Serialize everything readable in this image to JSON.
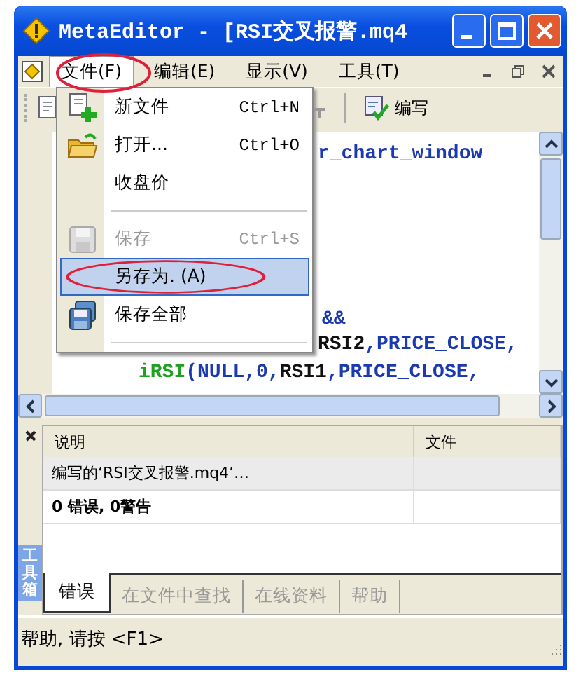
{
  "window": {
    "title": "MetaEditor - [RSI交叉报警.mq4"
  },
  "menu_bar": {
    "items": [
      {
        "label": "文件(F)",
        "selected": true
      },
      {
        "label": "编辑(E)",
        "selected": false
      },
      {
        "label": "显示(V)",
        "selected": false
      },
      {
        "label": "工具(T)",
        "selected": false
      }
    ]
  },
  "toolbar": {
    "buttons": [
      {
        "label": "编写"
      }
    ]
  },
  "file_menu": {
    "items": [
      {
        "kind": "item",
        "label": "新文件",
        "shortcut": "Ctrl+N",
        "disabled": false,
        "selected": false
      },
      {
        "kind": "item",
        "label": "打开...",
        "shortcut": "Ctrl+O",
        "disabled": false,
        "selected": false
      },
      {
        "kind": "item",
        "label": "收盘价",
        "disabled": false,
        "selected": false
      },
      {
        "kind": "separator"
      },
      {
        "kind": "item",
        "label": "保存",
        "shortcut": "Ctrl+S",
        "disabled": true,
        "selected": false
      },
      {
        "kind": "item",
        "label": "另存为. (A)",
        "disabled": false,
        "selected": true
      },
      {
        "kind": "item",
        "label": "保存全部",
        "disabled": false,
        "selected": false
      },
      {
        "kind": "separator"
      }
    ]
  },
  "editor": {
    "lines": [
      {
        "tokens": [
          {
            "text": "r_chart_window",
            "kind": "const"
          }
        ]
      },
      {
        "tokens": [
          {
            "text": "&&",
            "kind": "const"
          }
        ]
      },
      {
        "tokens": [
          {
            "text": "RSI2",
            "kind": "ident"
          },
          {
            "text": ",PRICE_CLOSE,",
            "kind": "const"
          }
        ]
      },
      {
        "tokens": [
          {
            "text": "iRSI",
            "kind": "func"
          },
          {
            "text": "(NULL,0,",
            "kind": "const"
          },
          {
            "text": "RSI1",
            "kind": "ident"
          },
          {
            "text": ",PRICE_CLOSE,",
            "kind": "const"
          }
        ]
      }
    ]
  },
  "toolbox": {
    "title": "工具箱",
    "columns": [
      "说明",
      "文件"
    ],
    "rows": [
      {
        "description": "编写的‘RSI交叉报警.mq4’…",
        "bold": false,
        "selected": true
      },
      {
        "description": "0 错误, 0警告",
        "bold": true,
        "selected": false
      }
    ],
    "tabs": [
      {
        "label": "错误",
        "selected": true
      },
      {
        "label": "在文件中查找",
        "selected": false
      },
      {
        "label": "在线资料",
        "selected": false
      },
      {
        "label": "帮助",
        "selected": false
      }
    ]
  },
  "status_bar": {
    "text": "帮助, 请按 <F1>"
  }
}
